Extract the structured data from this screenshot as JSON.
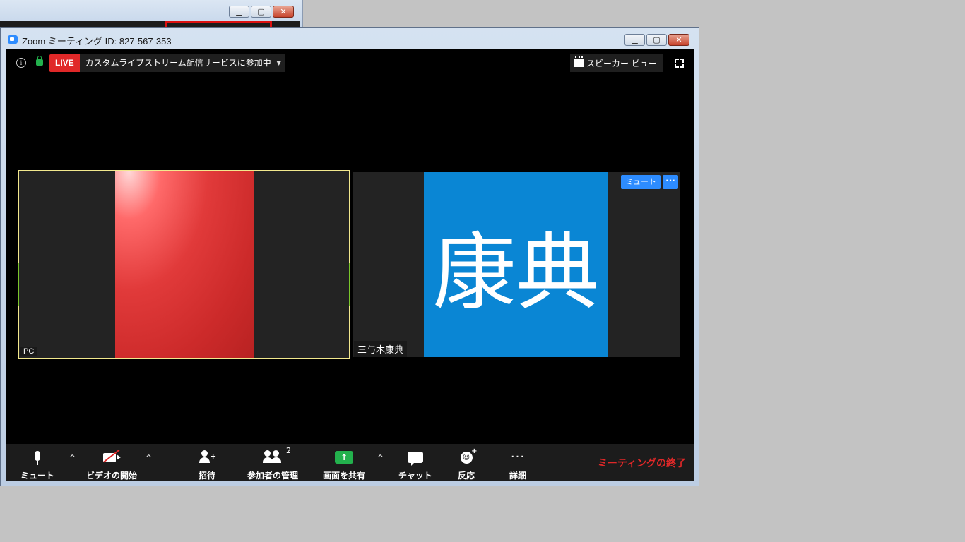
{
  "background_window": {
    "minimize": "▁",
    "maximize": "▢",
    "close": "✕"
  },
  "window": {
    "title": "Zoom ミーティング ID: 827-567-353",
    "minimize": "▁",
    "maximize": "▢",
    "close": "✕"
  },
  "topbar": {
    "info_icon_glyph": "i",
    "live_label": "LIVE",
    "live_status": "カスタムライブストリーム配信サービスに参加中",
    "live_caret": "▼",
    "speaker_view_label": "スピーカー ビュー"
  },
  "participants": {
    "active_name": "PC",
    "right_avatar_text": "康典",
    "right_name": "三与木康典",
    "mute_button": "ミュート",
    "more_button": "···"
  },
  "toolbar": {
    "mute": "ミュート",
    "start_video": "ビデオの開始",
    "invite": "招待",
    "manage_participants": "参加者の管理",
    "participant_count": "2",
    "share_screen": "画面を共有",
    "share_glyph": "↑",
    "chat": "チャット",
    "reactions": "反応",
    "more": "詳細",
    "more_glyph": "···",
    "caret": "^",
    "end_meeting": "ミーティングの終了"
  },
  "colors": {
    "live_red": "#e02828",
    "accent_blue": "#2d8cff",
    "avatar_blue": "#0a86d4",
    "share_green": "#23b14d",
    "active_border": "#f2e88d"
  }
}
